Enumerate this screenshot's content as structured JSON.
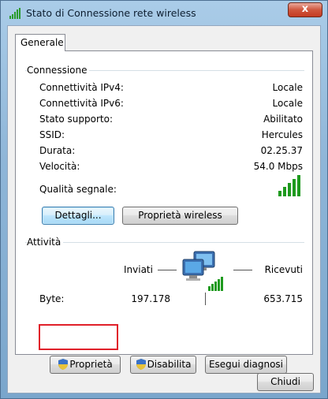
{
  "window": {
    "title": "Stato di Connessione rete wireless",
    "close_label": "x"
  },
  "tab": {
    "label": "Generale"
  },
  "connection": {
    "group_label": "Connessione",
    "rows": [
      {
        "label": "Connettività IPv4:",
        "value": "Locale"
      },
      {
        "label": "Connettività IPv6:",
        "value": "Locale"
      },
      {
        "label": "Stato supporto:",
        "value": "Abilitato"
      },
      {
        "label": "SSID:",
        "value": "Hercules"
      },
      {
        "label": "Durata:",
        "value": "02.25.37"
      },
      {
        "label": "Velocità:",
        "value": "54.0 Mbps"
      }
    ],
    "signal_label": "Qualità segnale:",
    "signal_bars": 5,
    "details_button": "Dettagli...",
    "wireless_props_button": "Proprietà wireless"
  },
  "activity": {
    "group_label": "Attività",
    "sent_label": "Inviati",
    "received_label": "Ricevuti",
    "bytes_label": "Byte:",
    "sent_bytes": "197.178",
    "received_bytes": "653.715"
  },
  "actions": {
    "properties_button": "Proprietà",
    "disable_button": "Disabilita",
    "diagnose_button": "Esegui diagnosi",
    "close_button": "Chiudi"
  },
  "colors": {
    "highlight": "#e0202a",
    "signal": "#1e9a1e"
  }
}
